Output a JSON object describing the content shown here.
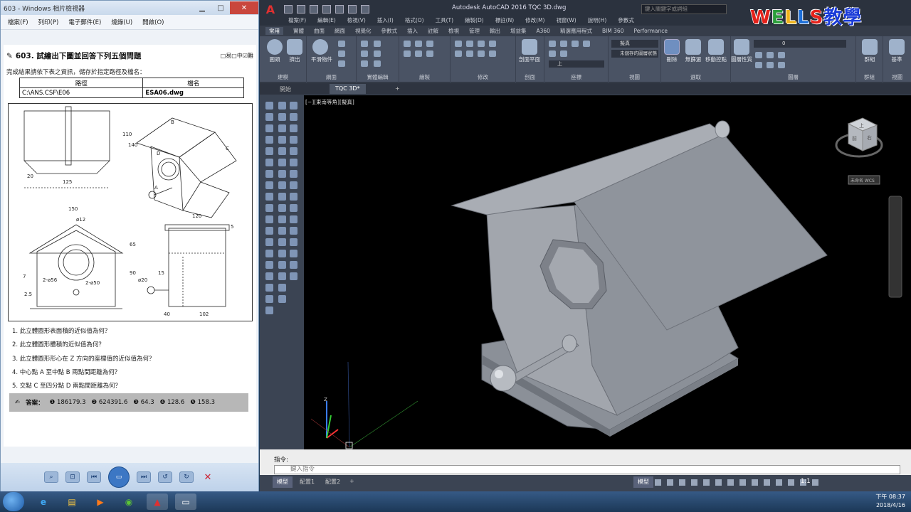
{
  "viewer": {
    "title": "603 - Windows 相片檢視器",
    "menu": [
      "檔案(F)",
      "列印(P)",
      "電子郵件(E)",
      "燒錄(U)",
      "開啟(O)"
    ],
    "question_title": "603. 試繪出下圖並回答下列五個問題",
    "question_options": "□易□中☑難",
    "instruction": "完成結果請依下表之資訊，儲存於指定路徑及檔名：",
    "table_headers": [
      "路徑",
      "檔名"
    ],
    "table_row": [
      "C:\\ANS.CSF\\E06",
      "ESA06.dwg"
    ],
    "questions": [
      "1. 此立體圖形表面積的近似值為何？",
      "2. 此立體圖形體積的近似值為何？",
      "3. 此立體圖形形心在 Z 方向的座標值的近似值為何？",
      "4. 中心點 A 至中點 B 兩點間距離為何？",
      "5. 交點 C 至四分點 D 兩點間距離為何？"
    ],
    "answer_label": "答案：",
    "answers": [
      "❶ 186179.3",
      "❷ 624391.6",
      "❸ 64.3",
      "❹ 128.6",
      "❺ 158.3"
    ],
    "drawing_labels": {
      "A": "A",
      "B": "B",
      "C": "C",
      "D": "D",
      "dims": [
        "110",
        "140",
        "125",
        "20",
        "150",
        "120",
        "ø12",
        "65",
        "90",
        "2-ø56",
        "2-ø50",
        "7",
        "2.5",
        "ø20",
        "40",
        "15",
        "102",
        "5"
      ]
    }
  },
  "acad": {
    "title": "Autodesk AutoCAD 2016  TQC 3D.dwg",
    "search_placeholder": "鍵入關鍵字或詞組",
    "menus": [
      "檔案(F)",
      "編輯(E)",
      "檢視(V)",
      "插入(I)",
      "格式(O)",
      "工具(T)",
      "繪製(D)",
      "標註(N)",
      "修改(M)",
      "視窗(W)",
      "說明(H)",
      "參數式"
    ],
    "ribbon_tabs": [
      "常用",
      "實體",
      "曲面",
      "網面",
      "視覺化",
      "參數式",
      "插入",
      "註解",
      "檢視",
      "管理",
      "輸出",
      "增益集",
      "A360",
      "精選應用程式",
      "BIM 360",
      "Performance"
    ],
    "ribbon_panels": [
      "建模",
      "網面",
      "實體編輯",
      "繪製",
      "修改",
      "剖面",
      "座標",
      "視圖",
      "選取",
      "圖層",
      "群組",
      "視圖"
    ],
    "ribbon_buttons": [
      "圓頭",
      "擠出",
      "平滑物件",
      "剖面平面",
      "刪除",
      "無篩選",
      "移動控點",
      "圖層性質",
      "群組",
      "基準"
    ],
    "visual_style": "擬真",
    "layer_state": "未儲存的圖層狀態",
    "layer_name": "0",
    "ucs": "上",
    "doc_tabs": [
      "開始",
      "TQC 3D*"
    ],
    "viewport_label": "[−][東南等角][擬真]",
    "viewcube_faces": [
      "上",
      "前",
      "右"
    ],
    "viewcube_wcs": "未命名 WCS",
    "cmd_history": "指令:",
    "cmd_placeholder": "鍵入指令",
    "layout_tabs": [
      "模型",
      "配置1",
      "配置2"
    ],
    "status_model": "模型",
    "annotation_scale": "1:1"
  },
  "watermark": [
    "W",
    "E",
    "L",
    "L",
    "S",
    "教學"
  ],
  "taskbar": {
    "time": "下午 08:37",
    "date": "2018/4/16"
  },
  "colors": {
    "canvas_bg": "#000000",
    "model_grey": "#9da1a8",
    "ribbon_bg": "#4a5364",
    "accent_red": "#e03030"
  }
}
